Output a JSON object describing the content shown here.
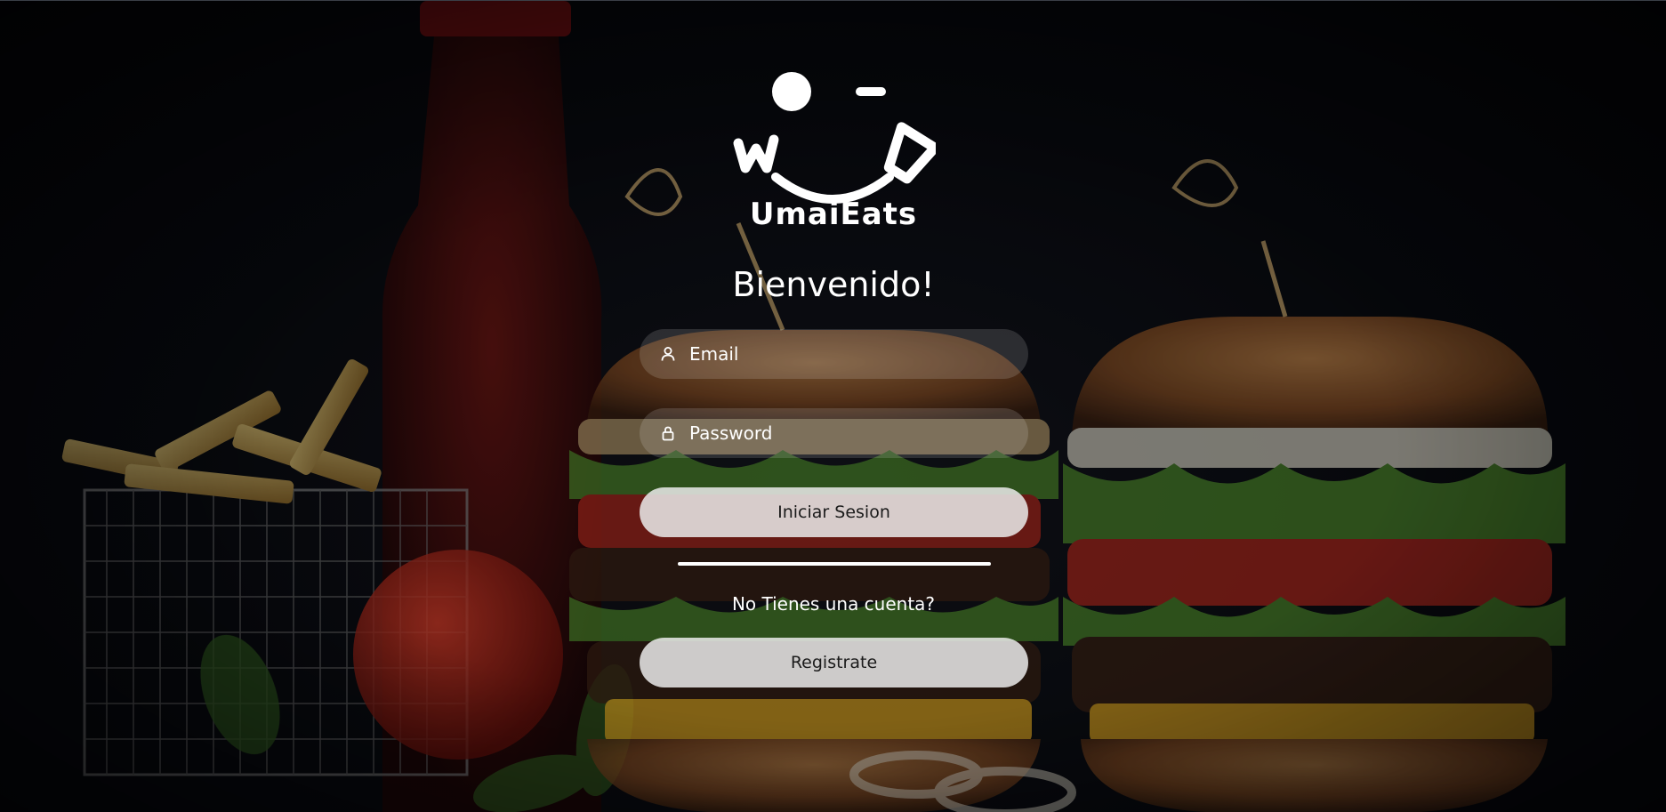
{
  "brand": {
    "name": "UmaiEats",
    "logo_icon": "smiling-face-logo"
  },
  "login": {
    "heading": "Bienvenido!",
    "email_placeholder": "Email",
    "email_icon": "user-icon",
    "password_placeholder": "Password",
    "password_icon": "lock-icon",
    "submit_label": "Iniciar Sesion",
    "no_account_text": "No Tienes una cuenta?",
    "register_label": "Registrate"
  },
  "colors": {
    "background": "#05070b",
    "text": "#ffffff",
    "field_bg": "rgba(255,255,255,0.14)",
    "button_bg": "#eaeaea"
  }
}
